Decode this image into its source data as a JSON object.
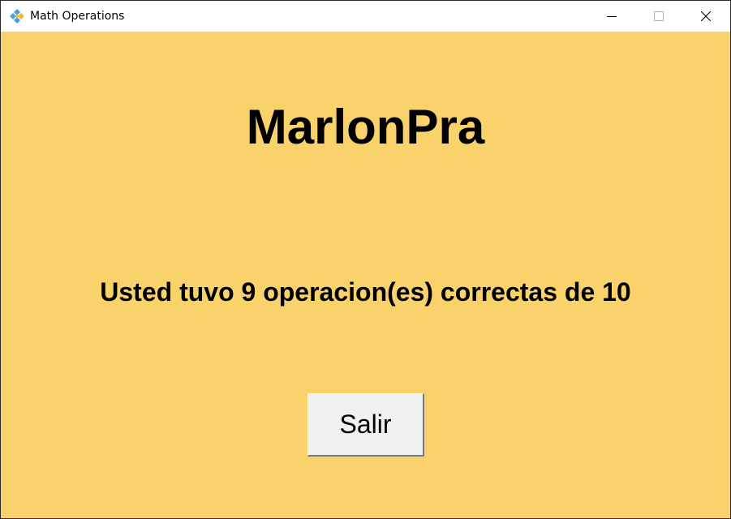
{
  "window": {
    "title": "Math Operations",
    "app_icon": "tk-feather-icon",
    "controls": {
      "minimize_icon": "minimize-icon",
      "maximize_icon": "maximize-icon",
      "close_icon": "close-icon"
    }
  },
  "main": {
    "heading": "MarlonPra",
    "result_text": "Usted tuvo 9 operacion(es) correctas de 10",
    "exit_button_label": "Salir"
  },
  "colors": {
    "background": "#fad26b",
    "button_face": "#f0f0f0",
    "text": "#000000"
  }
}
